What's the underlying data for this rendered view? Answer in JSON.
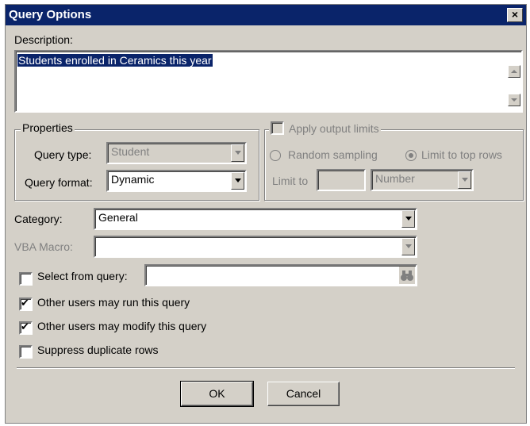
{
  "window": {
    "title": "Query Options",
    "close_glyph": "×"
  },
  "description": {
    "label": "Description:",
    "value": "Students enrolled in Ceramics this year"
  },
  "properties": {
    "legend": "Properties",
    "query_type_label": "Query type:",
    "query_type_value": "Student",
    "query_format_label": "Query format:",
    "query_format_value": "Dynamic"
  },
  "output_limits": {
    "legend": "Apply output limits",
    "random_sampling_label": "Random sampling",
    "limit_top_label": "Limit to top rows",
    "limit_to_label": "Limit to",
    "limit_to_value": "",
    "unit_value": "Number"
  },
  "category": {
    "label": "Category:",
    "value": "General"
  },
  "vba_macro": {
    "label": "VBA Macro:",
    "value": ""
  },
  "select_from_query": {
    "label": "Select from query:",
    "value": ""
  },
  "options": {
    "others_run": "Other users may run this query",
    "others_modify": "Other users may modify this query",
    "suppress_dupes": "Suppress duplicate rows"
  },
  "buttons": {
    "ok": "OK",
    "cancel": "Cancel"
  }
}
